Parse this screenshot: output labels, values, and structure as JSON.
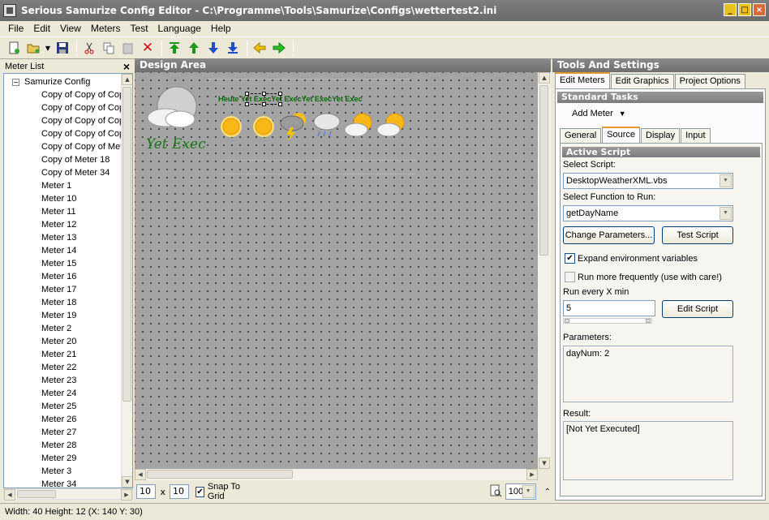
{
  "window": {
    "title": "Serious Samurize Config Editor - C:\\Programme\\Tools\\Samurize\\Configs\\wettertest2.ini"
  },
  "menu": [
    "File",
    "Edit",
    "View",
    "Meters",
    "Test",
    "Language",
    "Help"
  ],
  "toolbar_icons": [
    "new-icon",
    "open-icon",
    "save-icon",
    "cut-icon",
    "copy-icon",
    "paste-icon",
    "delete-icon",
    "move-top-icon",
    "move-up-icon",
    "move-down-icon",
    "move-bottom-icon",
    "arrow-left-icon",
    "arrow-right-icon"
  ],
  "meter_list": {
    "title": "Meter List",
    "close": "×",
    "root": "Samurize Config",
    "items": [
      "Copy of Copy of Cop",
      "Copy of Copy of Cop",
      "Copy of Copy of Cop",
      "Copy of Copy of Cop",
      "Copy of Copy of Met",
      "Copy of Meter 18",
      "Copy of Meter 34",
      "Meter 1",
      "Meter 10",
      "Meter 11",
      "Meter 12",
      "Meter 13",
      "Meter 14",
      "Meter 15",
      "Meter 16",
      "Meter 17",
      "Meter 18",
      "Meter 19",
      "Meter 2",
      "Meter 20",
      "Meter 21",
      "Meter 22",
      "Meter 23",
      "Meter 24",
      "Meter 25",
      "Meter 26",
      "Meter 27",
      "Meter 28",
      "Meter 29",
      "Meter 3",
      "Meter 34"
    ]
  },
  "design": {
    "title": "Design Area",
    "headline": "Heute Yet ExecYet ExecYet ExecYet Exec",
    "big_text": "Yet Exec",
    "grid_x": "10",
    "grid_sep": "x",
    "grid_y": "10",
    "snap_label": "Snap To Grid",
    "zoom": "100%"
  },
  "right": {
    "title": "Tools And Settings",
    "tabs": [
      "Edit Meters",
      "Edit Graphics",
      "Project Options"
    ],
    "standard_tasks": "Standard Tasks",
    "add_meter": "Add Meter",
    "subtabs": [
      "General",
      "Source",
      "Display",
      "Input"
    ],
    "active_script": "Active Script",
    "select_script_label": "Select Script:",
    "script_value": "DesktopWeatherXML.vbs",
    "select_function_label": "Select Function to Run:",
    "function_value": "getDayName",
    "change_params_btn": "Change Parameters...",
    "test_script_btn": "Test Script",
    "expand_env_label": "Expand environment variables",
    "run_freq_label": "Run more frequently (use with care!)",
    "run_every_label": "Run every X min",
    "run_every_value": "5",
    "edit_script_btn": "Edit Script",
    "parameters_label": "Parameters:",
    "parameters_value": "dayNum: 2",
    "result_label": "Result:",
    "result_value": "[Not Yet Executed]"
  },
  "status": "Width: 40  Height: 12  (X: 140  Y: 30)"
}
